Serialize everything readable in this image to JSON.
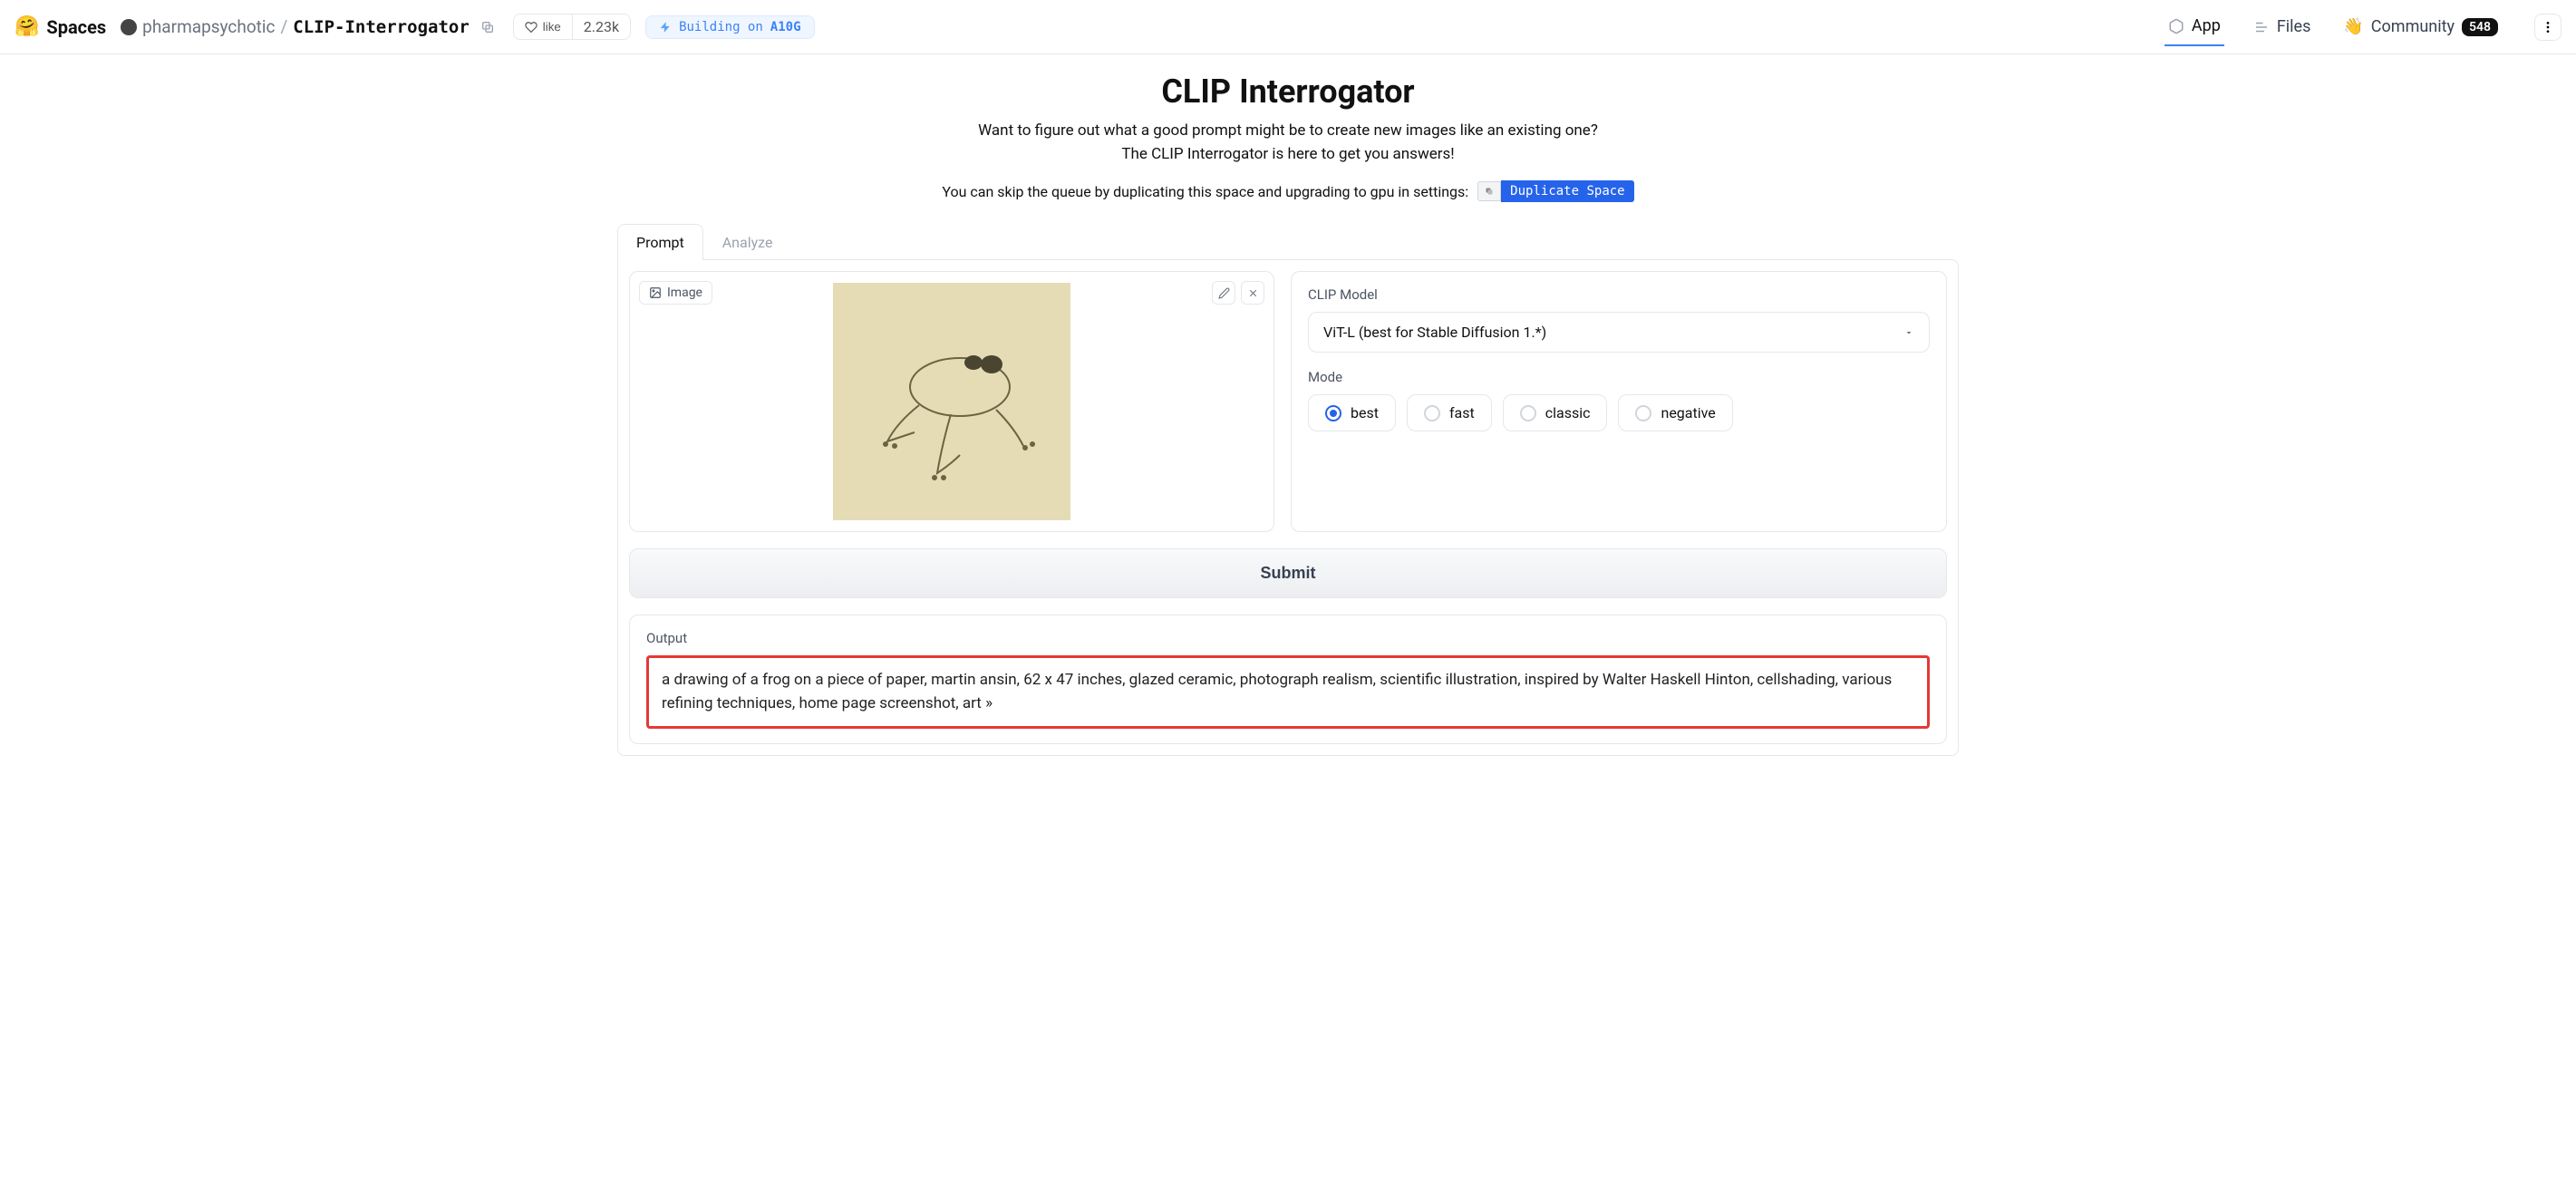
{
  "topbar": {
    "spaces_label": "Spaces",
    "author": "pharmapsychotic",
    "space_name": "CLIP-Interrogator",
    "like_label": "like",
    "like_count": "2.23k",
    "hardware_prefix": "Building on",
    "hardware_name": "A10G"
  },
  "nav": {
    "app": "App",
    "files": "Files",
    "community": "Community",
    "community_count": "548"
  },
  "hero": {
    "title": "CLIP Interrogator",
    "line1": "Want to figure out what a good prompt might be to create new images like an existing one?",
    "line2": "The CLIP Interrogator is here to get you answers!",
    "skip_line": "You can skip the queue by duplicating this space and upgrading to gpu in settings:",
    "dup_badge": "Duplicate Space"
  },
  "tabs": {
    "prompt": "Prompt",
    "analyze": "Analyze"
  },
  "image_panel": {
    "label": "Image"
  },
  "settings": {
    "clip_model_label": "CLIP Model",
    "clip_model_value": "ViT-L (best for Stable Diffusion 1.*)",
    "mode_label": "Mode",
    "modes": {
      "best": "best",
      "fast": "fast",
      "classic": "classic",
      "negative": "negative"
    }
  },
  "submit": {
    "label": "Submit"
  },
  "output": {
    "label": "Output",
    "text": "a drawing of a frog on a piece of paper, martin ansin, 62 x 47 inches, glazed ceramic, photograph realism, scientific illustration, inspired by Walter Haskell Hinton, cellshading, various refining techniques, home page screenshot, art »"
  }
}
